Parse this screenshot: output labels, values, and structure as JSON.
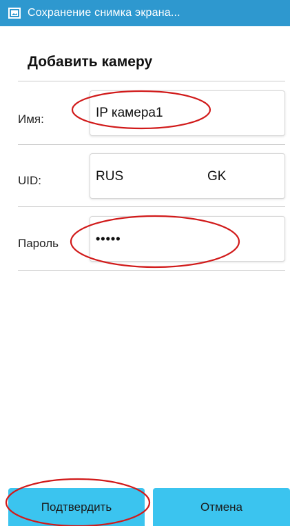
{
  "statusbar": {
    "icon": "gallery-icon",
    "text": "Сохранение снимка экрана..."
  },
  "dialog": {
    "title": "Добавить камеру"
  },
  "fields": {
    "name": {
      "label": "Имя:",
      "value": "IP камера1"
    },
    "uid": {
      "label": "UID:",
      "value_left": "RUS",
      "value_right": "GK"
    },
    "password": {
      "label": "Пароль",
      "value": "•••••"
    }
  },
  "buttons": {
    "confirm": "Подтвердить",
    "cancel": "Отмена"
  },
  "colors": {
    "accent": "#2e98cf",
    "button": "#3bc4ef",
    "annotation": "#d11a1a"
  }
}
